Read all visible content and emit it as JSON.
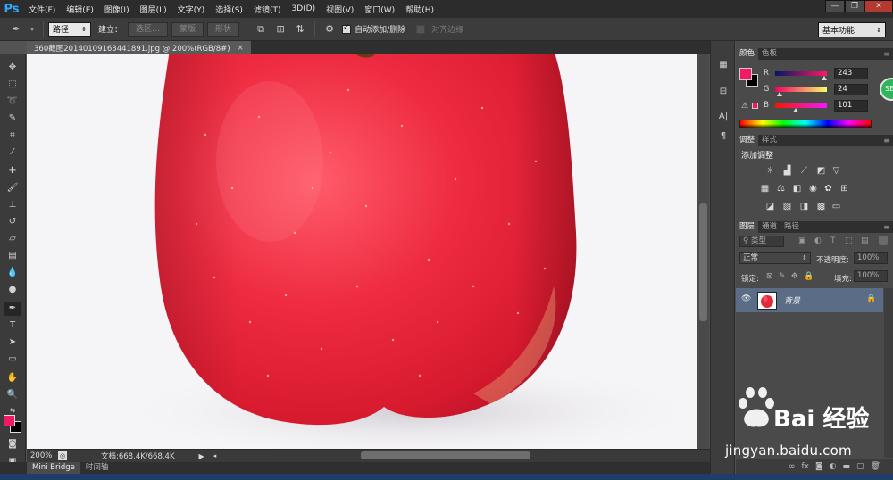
{
  "app": {
    "logo": "Ps",
    "menus": [
      "文件(F)",
      "编辑(E)",
      "图像(I)",
      "图层(L)",
      "文字(Y)",
      "选择(S)",
      "滤镜(T)",
      "3D(D)",
      "视图(V)",
      "窗口(W)",
      "帮助(H)"
    ],
    "window_controls": [
      "—",
      "❐",
      "✕"
    ]
  },
  "options_bar": {
    "mode_select": "路径",
    "build_label": "建立：",
    "btn_selection": "选区…",
    "btn_mask": "蒙版",
    "btn_shape": "形状",
    "auto_add_delete_label": "自动添加/删除",
    "auto_add_delete_checked": true,
    "align_edges_label": "对齐边缘",
    "align_edges_checked": false,
    "workspace": "基本功能"
  },
  "document": {
    "tab_title": "360截图20140109163441891.jpg @ 200%(RGB/8#)",
    "tab_close": "×"
  },
  "status": {
    "zoom": "200%",
    "doc_info": "文档:668.4K/668.4K"
  },
  "bottom_tabs": [
    "Mini Bridge",
    "时间轴"
  ],
  "color_panel": {
    "tabs": [
      "颜色",
      "色板"
    ],
    "foreground": "#f31865",
    "background": "#000000",
    "channels": [
      {
        "label": "R",
        "value": "243",
        "fraction": 0.953
      },
      {
        "label": "G",
        "value": "24",
        "fraction": 0.094
      },
      {
        "label": "B",
        "value": "101",
        "fraction": 0.396
      }
    ]
  },
  "adjustments_panel": {
    "tabs": [
      "调整",
      "样式"
    ],
    "title": "添加调整"
  },
  "layers_panel": {
    "tabs": [
      "图层",
      "通道",
      "路径"
    ],
    "filter_kind": "类型",
    "blend_mode": "正常",
    "opacity_label": "不透明度:",
    "opacity_value": "100%",
    "lock_label": "锁定:",
    "fill_label": "填充:",
    "fill_value": "100%",
    "layers": [
      {
        "name": "背景",
        "visible": true,
        "locked": true
      }
    ]
  },
  "watermark": {
    "brand": "Bai 经验",
    "url": "jingyan.baidu.com"
  },
  "colors": {
    "apple_red": "#e8283c",
    "selection_blue": "#5b6c86"
  }
}
